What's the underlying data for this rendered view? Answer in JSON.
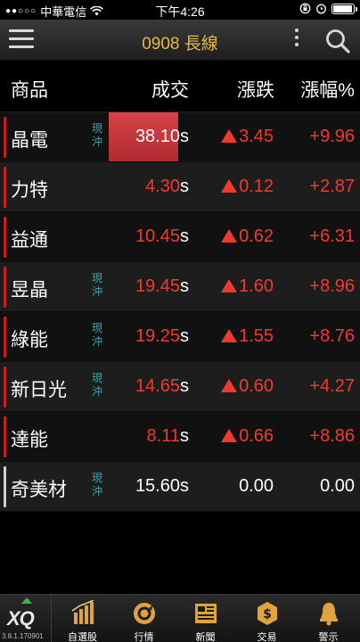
{
  "status_bar": {
    "carrier": "中華電信",
    "time": "下午4:26"
  },
  "title_bar": {
    "title": "0908 長線"
  },
  "columns": {
    "name": "商品",
    "price": "成交",
    "change": "漲跌",
    "pct": "漲幅%"
  },
  "colors": {
    "up": "#f03a2e",
    "tag": "#2fa8b4",
    "title": "#e6b94a"
  },
  "rows": [
    {
      "name": "晶電",
      "tag": "現沖",
      "price": "38.10",
      "suffix": "s",
      "change": "3.45",
      "pct": "+9.96",
      "direction": "up",
      "highlight": true
    },
    {
      "name": "力特",
      "tag": "",
      "price": "4.30",
      "suffix": "s",
      "change": "0.12",
      "pct": "+2.87",
      "direction": "up",
      "highlight": false
    },
    {
      "name": "益通",
      "tag": "",
      "price": "10.45",
      "suffix": "s",
      "change": "0.62",
      "pct": "+6.31",
      "direction": "up",
      "highlight": false
    },
    {
      "name": "昱晶",
      "tag": "現沖",
      "price": "19.45",
      "suffix": "s",
      "change": "1.60",
      "pct": "+8.96",
      "direction": "up",
      "highlight": false
    },
    {
      "name": "綠能",
      "tag": "現沖",
      "price": "19.25",
      "suffix": "s",
      "change": "1.55",
      "pct": "+8.76",
      "direction": "up",
      "highlight": false
    },
    {
      "name": "新日光",
      "tag": "現沖",
      "price": "14.65",
      "suffix": "s",
      "change": "0.60",
      "pct": "+4.27",
      "direction": "up",
      "highlight": false
    },
    {
      "name": "達能",
      "tag": "",
      "price": "8.11",
      "suffix": "s",
      "change": "0.66",
      "pct": "+8.86",
      "direction": "up",
      "highlight": false
    },
    {
      "name": "奇美材",
      "tag": "現沖",
      "price": "15.60",
      "suffix": "s",
      "change": "0.00",
      "pct": "0.00",
      "direction": "flat",
      "highlight": false
    }
  ],
  "tab_bar": {
    "logo": "XQ",
    "version": "3.8.1.170901",
    "tabs": [
      {
        "label": "自選股",
        "icon": "bar-chart-icon"
      },
      {
        "label": "行情",
        "icon": "refresh-circle-icon"
      },
      {
        "label": "新聞",
        "icon": "newspaper-icon"
      },
      {
        "label": "交易",
        "icon": "exchange-icon"
      },
      {
        "label": "警示",
        "icon": "bell-icon"
      }
    ]
  }
}
